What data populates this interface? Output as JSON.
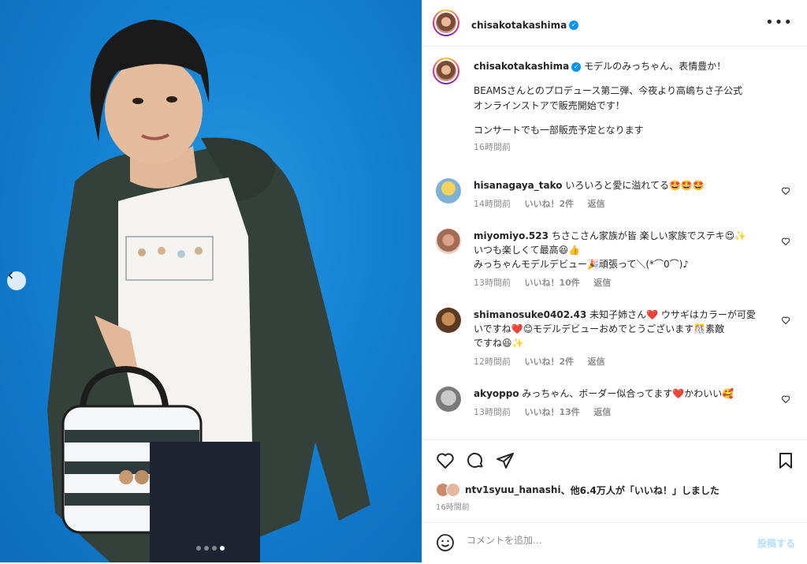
{
  "post": {
    "author": "chisakotakashima",
    "caption_lines": [
      "モデルのみっちゃん、表情豊か！",
      "BEAMSさんとのプロデュース第二弾、今夜より高嶋ちさ子公式",
      "オンラインストアで販売開始です！",
      "コンサートでも一部販売予定となります"
    ],
    "caption_time": "16時間前"
  },
  "carousel": {
    "total": 4,
    "active_index": 3
  },
  "comments": [
    {
      "user": "hisanagaya_tako",
      "lines": [
        "いろいろと愛に溢れてる🤩🤩🤩"
      ],
      "time": "14時間前",
      "likes": "いいね！2件",
      "reply": "返信"
    },
    {
      "user": "miyomiyo.523",
      "lines": [
        "ちさこさん家族が皆 楽しい家族でステキ😍✨",
        "いつも楽しくて最高😆👍",
        "みっちゃんモデルデビュー🎉頑張って＼(*⌒0⌒)♪"
      ],
      "time": "13時間前",
      "likes": "いいね！10件",
      "reply": "返信"
    },
    {
      "user": "shimanosuke0402.43",
      "lines": [
        "未知子姉さん❤️ ウサギはカラーが可愛",
        "いですね❤️😊モデルデビューおめでとうございます🎊素敵",
        "ですね😆✨"
      ],
      "time": "12時間前",
      "likes": "いいね！2件",
      "reply": "返信"
    },
    {
      "user": "akyoppo",
      "lines": [
        "みっちゃん、ボーダー似合ってます❤️かわいい🥰"
      ],
      "time": "13時間前",
      "likes": "いいね！13件",
      "reply": "返信"
    }
  ],
  "likes_summary": {
    "user": "ntv1syuu_hanashi",
    "text": "、他6.4万人が「いいね！」しました"
  },
  "post_time": "16時間前",
  "comment_box": {
    "placeholder": "コメントを追加...",
    "post_label": "投稿する"
  },
  "colors": {
    "accent": "#0095f6",
    "photo_bg": "#1481d2",
    "post_disabled": "#b2dffc"
  }
}
